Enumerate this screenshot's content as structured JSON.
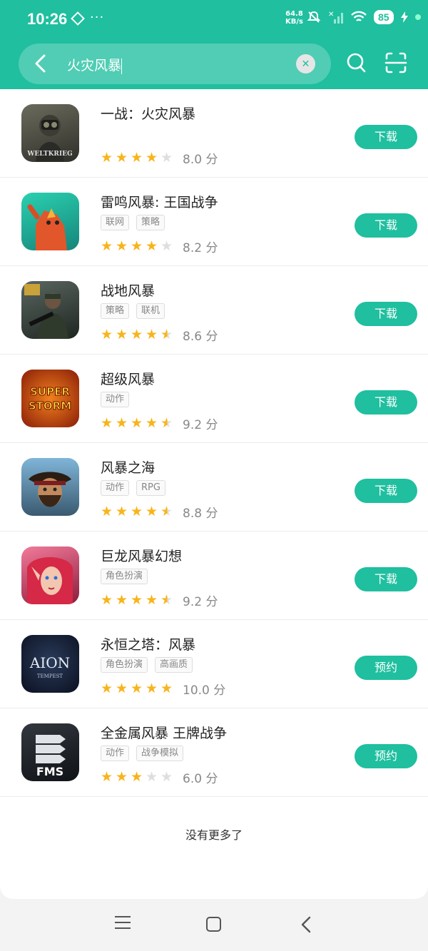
{
  "status_bar": {
    "time": "10:26",
    "dots": "···",
    "net_speed_value": "64.8",
    "net_speed_unit": "KB/s",
    "battery": "85"
  },
  "search": {
    "query": "火灾风暴",
    "icons": {
      "back": "back-arrow-icon",
      "clear": "clear-icon",
      "search": "search-icon",
      "scan": "scan-icon"
    }
  },
  "colors": {
    "accent": "#1fbf9f",
    "star": "#f8b41b"
  },
  "apps": [
    {
      "name": "一战：火灾风暴",
      "tags": [],
      "rating": 4,
      "score": "8.0 分",
      "action": "下载",
      "icon_text": "WELTKRIEG"
    },
    {
      "name": "雷鸣风暴: 王国战争",
      "tags": [
        "联网",
        "策略"
      ],
      "rating": 4,
      "score": "8.2 分",
      "action": "下载",
      "icon_text": ""
    },
    {
      "name": "战地风暴",
      "tags": [
        "策略",
        "联机"
      ],
      "rating": 4.5,
      "score": "8.6 分",
      "action": "下载",
      "icon_text": ""
    },
    {
      "name": "超级风暴",
      "tags": [
        "动作"
      ],
      "rating": 4.5,
      "score": "9.2 分",
      "action": "下载",
      "icon_text": "SUPER STORM"
    },
    {
      "name": "风暴之海",
      "tags": [
        "动作",
        "RPG"
      ],
      "rating": 4.5,
      "score": "8.8 分",
      "action": "下载",
      "icon_text": ""
    },
    {
      "name": "巨龙风暴幻想",
      "tags": [
        "角色扮演"
      ],
      "rating": 4.5,
      "score": "9.2 分",
      "action": "下载",
      "icon_text": ""
    },
    {
      "name": "永恒之塔：风暴",
      "tags": [
        "角色扮演",
        "高画质"
      ],
      "rating": 5,
      "score": "10.0 分",
      "action": "预约",
      "icon_text": "AION"
    },
    {
      "name": "全金属风暴 王牌战争",
      "tags": [
        "动作",
        "战争模拟"
      ],
      "rating": 3,
      "score": "6.0 分",
      "action": "预约",
      "icon_text": "FMS"
    }
  ],
  "footer": {
    "no_more": "没有更多了"
  },
  "nav": {
    "menu": "menu-icon",
    "home": "home-icon",
    "back": "back-icon"
  }
}
